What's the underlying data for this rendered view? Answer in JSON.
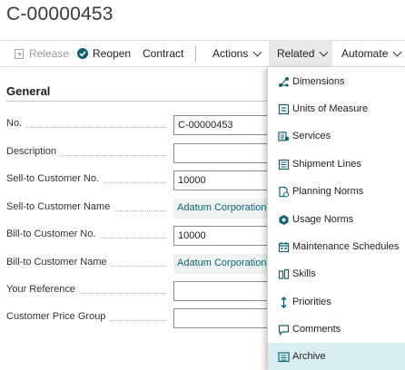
{
  "page": {
    "title": "C-00000453"
  },
  "actions": {
    "release": "Release",
    "reopen": "Reopen",
    "contract": "Contract",
    "actions": "Actions",
    "related": "Related",
    "automate": "Automate"
  },
  "section": {
    "title": "General"
  },
  "fields": [
    {
      "label": "No.",
      "value": "C-00000453",
      "type": "input"
    },
    {
      "label": "Description",
      "value": "",
      "type": "input"
    },
    {
      "label": "Sell-to Customer No.",
      "value": "10000",
      "type": "input"
    },
    {
      "label": "Sell-to Customer Name",
      "value": "Adatum Corporation",
      "type": "lookup"
    },
    {
      "label": "Bill-to Customer No.",
      "value": "10000",
      "type": "input"
    },
    {
      "label": "Bill-to Customer Name",
      "value": "Adatum Corporation",
      "type": "lookup"
    },
    {
      "label": "Your Reference",
      "value": "",
      "type": "input"
    },
    {
      "label": "Customer Price Group",
      "value": "",
      "type": "input"
    }
  ],
  "related_menu": [
    {
      "label": "Dimensions",
      "icon": "dimensions-icon"
    },
    {
      "label": "Units of Measure",
      "icon": "units-icon"
    },
    {
      "label": "Services",
      "icon": "services-icon"
    },
    {
      "label": "Shipment Lines",
      "icon": "shipment-lines-icon"
    },
    {
      "label": "Planning Norms",
      "icon": "planning-norms-icon"
    },
    {
      "label": "Usage Norms",
      "icon": "usage-norms-icon"
    },
    {
      "label": "Maintenance Schedules",
      "icon": "maintenance-schedules-icon"
    },
    {
      "label": "Skills",
      "icon": "skills-icon"
    },
    {
      "label": "Priorities",
      "icon": "priorities-icon"
    },
    {
      "label": "Comments",
      "icon": "comments-icon"
    },
    {
      "label": "Archive",
      "icon": "archive-icon"
    }
  ],
  "colors": {
    "accent": "#106470",
    "hover": "#d9eef1",
    "related_active": "#e8e8e8"
  }
}
